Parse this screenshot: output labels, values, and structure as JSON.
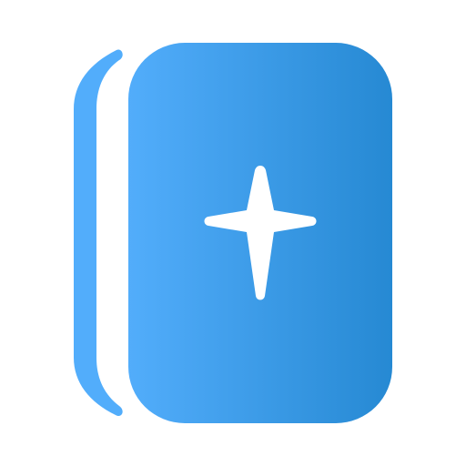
{
  "icon": {
    "name": "card-with-sparkle-icon",
    "parts": [
      "back-card-spine",
      "front-card",
      "sparkle-star"
    ]
  },
  "colors": {
    "background": "#ffffff",
    "gradient_start": "#52adfb",
    "gradient_end": "#2689d3",
    "spine": "#52adfb",
    "sparkle": "#ffffff"
  }
}
